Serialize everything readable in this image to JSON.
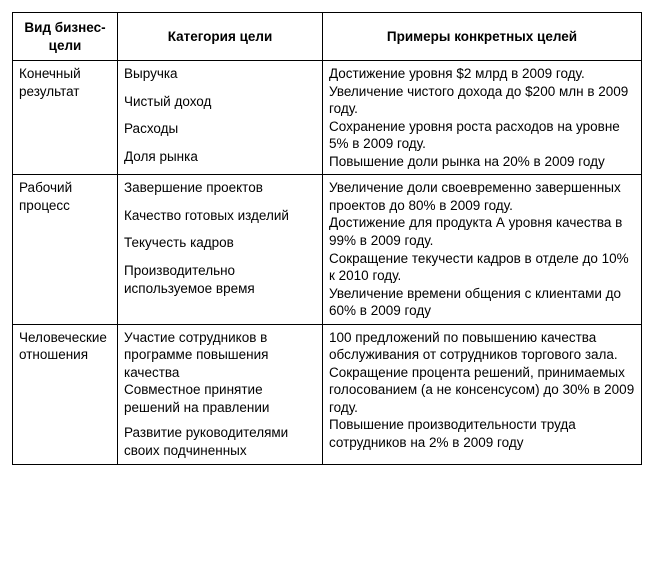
{
  "chart_data": {
    "type": "table",
    "headers": [
      "Вид бизнес-цели",
      "Категория цели",
      "Примеры конкретных целей"
    ],
    "rows": [
      {
        "type": "Конечный результат",
        "categories": [
          "Выручка",
          "Чистый доход",
          "Расходы",
          "Доля рынка"
        ],
        "examples": [
          "Достижение уровня $2 млрд в 2009 году.",
          "Увеличение чистого дохода до $200 млн в 2009 году.",
          "Сохранение уровня роста расходов на уровне 5% в 2009 году.",
          "Повышение доли рынка на 20% в 2009 году"
        ]
      },
      {
        "type": "Рабочий процесс",
        "categories": [
          "Завершение проектов",
          "Качество готовых изделий",
          "Текучесть кадров",
          "Производительно используемое время"
        ],
        "examples": [
          "Увеличение доли своевременно завершенных проектов до 80% в 2009 году.",
          "Достижение для продукта А уровня качества в 99% в 2009 году.",
          "Сокращение текучести кадров в отделе до 10% к 2010 году.",
          "Увеличение времени общения с клиентами до 60% в 2009 году"
        ]
      },
      {
        "type": "Человеческие отношения",
        "categories": [
          "Участие сотрудников в программе повышения качества",
          "Совместное принятие решений на правлении",
          "Развитие руководителями своих подчиненных"
        ],
        "examples": [
          "100 предложений по повышению качества обслуживания от сотрудников торгового зала.",
          "Сокращение процента решений, принимаемых голосованием (а не консенсусом) до 30% в 2009 году.",
          "Повышение производительности труда сотрудников на 2% в 2009 году"
        ]
      }
    ]
  },
  "headers": {
    "h0": "Вид бизнес-цели",
    "h1": "Категория цели",
    "h2": "Примеры конкретных целей"
  },
  "row0": {
    "type": "Конечный результат",
    "cat0": "Выручка",
    "cat1": "Чистый доход",
    "cat2": "Расходы",
    "cat3": "Доля рынка",
    "ex0": "Достижение уровня $2 млрд в 2009 году.",
    "ex1": "Увеличение чистого дохода до $200 млн в 2009 году.",
    "ex2": "Сохранение уровня роста расходов на уровне 5% в 2009 году.",
    "ex3": "Повышение доли рынка на 20% в 2009 году"
  },
  "row1": {
    "type": "Рабочий процесс",
    "cat0": "Завершение проектов",
    "cat1": "Качество готовых изделий",
    "cat2": "Текучесть кадров",
    "cat3": "Производительно используемое время",
    "ex0": "Увеличение доли своевременно завершенных проектов до 80% в 2009 году.",
    "ex1": "Достижение для продукта А уровня качества в 99% в 2009 году.",
    "ex2": "Сокращение текучести кадров в отделе до 10% к 2010 году.",
    "ex3": "Увеличение времени общения с клиентами до 60% в 2009 году"
  },
  "row2": {
    "type": "Человеческие отношения",
    "cat0": "Участие сотрудников в программе повышения качества",
    "cat1": "Совместное принятие решений на правлении",
    "cat2": "Развитие руководителями своих подчиненных",
    "ex0": "100 предложений по повышению качества обслуживания от сотрудников торгового зала.",
    "ex1": "Сокращение процента решений, принимаемых голосованием (а не консенсусом) до 30% в 2009 году.",
    "ex2": "Повышение производительности труда сотрудников на 2% в 2009 году"
  }
}
